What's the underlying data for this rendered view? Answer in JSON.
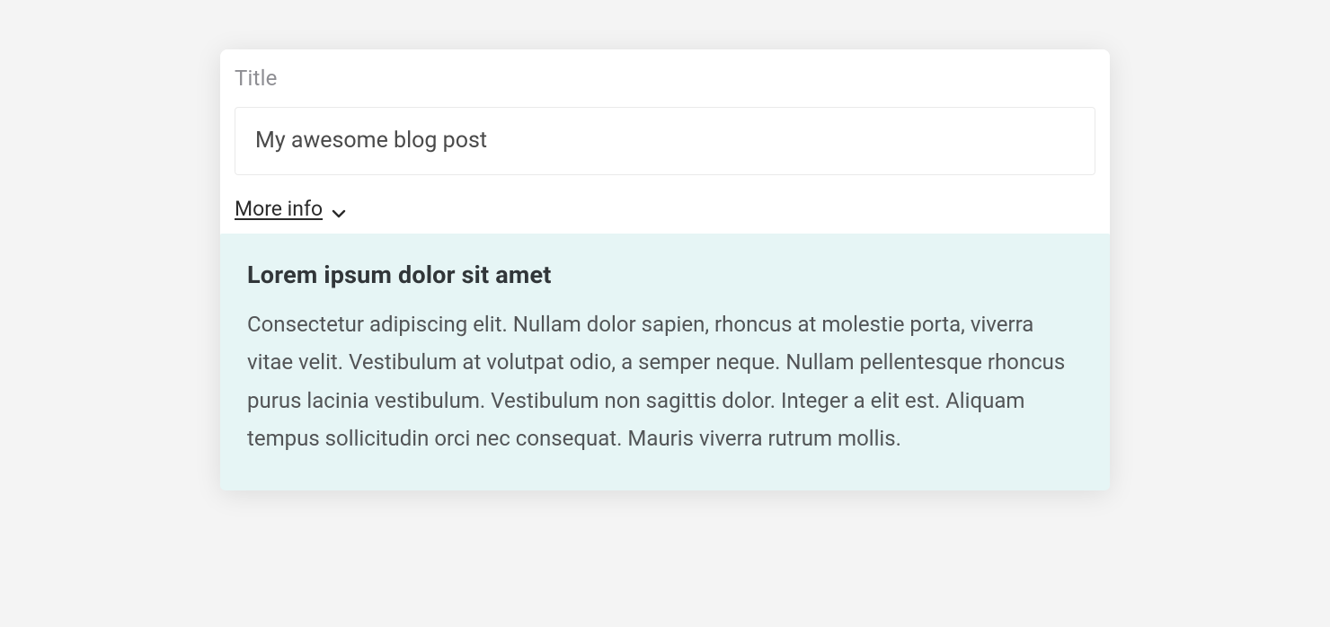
{
  "form": {
    "title_label": "Title",
    "title_value": "My awesome blog post"
  },
  "toggle": {
    "label": "More info"
  },
  "info": {
    "heading": "Lorem ipsum dolor sit amet",
    "body": "Consectetur adipiscing elit. Nullam dolor sapien, rhoncus at molestie porta, viverra vitae velit. Vestibulum at volutpat odio, a semper neque. Nullam pellentesque rhoncus purus lacinia vestibulum. Vestibulum non sagittis dolor. Integer a elit est. Aliquam tempus sollicitudin orci nec consequat. Mauris viverra rutrum mollis."
  }
}
